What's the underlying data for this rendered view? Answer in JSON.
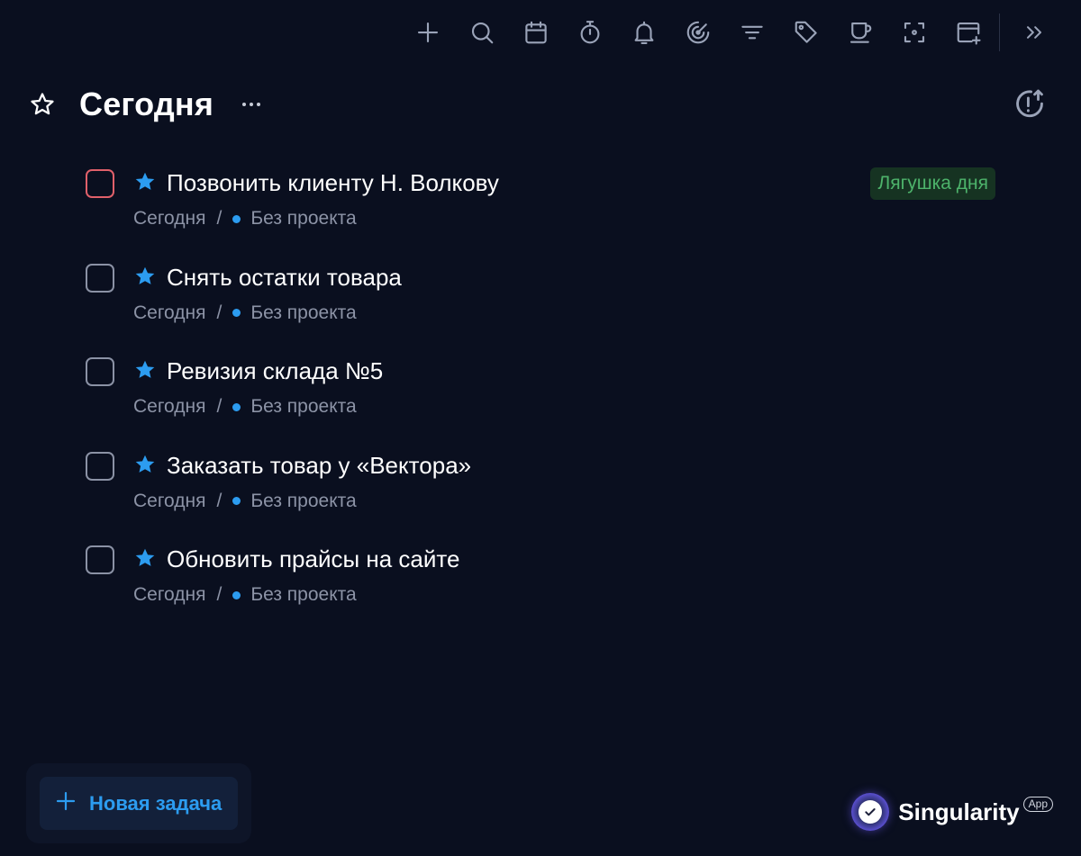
{
  "toolbar": {
    "items": [
      {
        "name": "add",
        "icon": "plus-icon"
      },
      {
        "name": "search",
        "icon": "search-icon"
      },
      {
        "name": "calendar",
        "icon": "calendar-icon"
      },
      {
        "name": "timer",
        "icon": "stopwatch-icon"
      },
      {
        "name": "reminders",
        "icon": "bell-icon"
      },
      {
        "name": "focus",
        "icon": "target-icon"
      },
      {
        "name": "filter",
        "icon": "filter-icon"
      },
      {
        "name": "tags",
        "icon": "tag-icon"
      },
      {
        "name": "break",
        "icon": "coffee-cup-icon"
      },
      {
        "name": "focus-mode",
        "icon": "focus-frame-icon"
      },
      {
        "name": "add-project",
        "icon": "folder-plus-icon"
      },
      {
        "name": "collapse",
        "icon": "chevrons-right-icon"
      }
    ]
  },
  "header": {
    "title": "Сегодня",
    "favorite_icon": "star-outline-icon",
    "menu_icon": "more-dots-icon",
    "right_icon": "priority-sort-icon"
  },
  "tasks": [
    {
      "title": "Позвонить клиенту Н. Волкову",
      "date": "Сегодня",
      "separator": "/",
      "project": "Без проекта",
      "badge": "Лягушка дня",
      "checkbox_color": "#e0606a"
    },
    {
      "title": "Снять остатки товара",
      "date": "Сегодня",
      "separator": "/",
      "project": "Без проекта",
      "badge": "",
      "checkbox_color": "#8b92a5"
    },
    {
      "title": "Ревизия склада №5",
      "date": "Сегодня",
      "separator": "/",
      "project": "Без проекта",
      "badge": "",
      "checkbox_color": "#8b92a5"
    },
    {
      "title": "Заказать товар у «Вектора»",
      "date": "Сегодня",
      "separator": "/",
      "project": "Без проекта",
      "badge": "",
      "checkbox_color": "#8b92a5"
    },
    {
      "title": "Обновить прайсы на сайте",
      "date": "Сегодня",
      "separator": "/",
      "project": "Без проекта",
      "badge": "",
      "checkbox_color": "#8b92a5"
    }
  ],
  "new_task": {
    "label": "Новая задача",
    "icon": "plus-icon"
  },
  "brand": {
    "name": "Singularity",
    "tag": "App",
    "logo_icon": "check-circle-icon"
  },
  "colors": {
    "background": "#0a0f1f",
    "accent": "#2c9cf0",
    "frog_badge_bg": "#163322",
    "frog_badge_text": "#4db36b",
    "muted_text": "#8c93a6"
  }
}
